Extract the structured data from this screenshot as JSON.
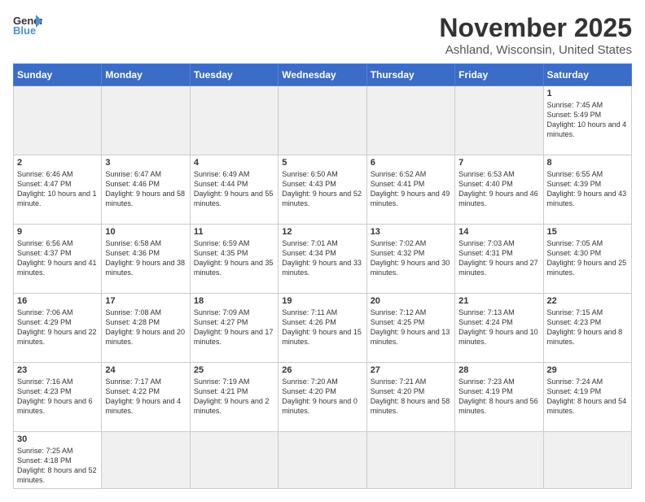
{
  "header": {
    "logo_general": "General",
    "logo_blue": "Blue",
    "month_year": "November 2025",
    "location": "Ashland, Wisconsin, United States"
  },
  "weekdays": [
    "Sunday",
    "Monday",
    "Tuesday",
    "Wednesday",
    "Thursday",
    "Friday",
    "Saturday"
  ],
  "weeks": [
    [
      {
        "day": "",
        "empty": true
      },
      {
        "day": "",
        "empty": true
      },
      {
        "day": "",
        "empty": true
      },
      {
        "day": "",
        "empty": true
      },
      {
        "day": "",
        "empty": true
      },
      {
        "day": "",
        "empty": true
      },
      {
        "day": "1",
        "info": "Sunrise: 7:45 AM\nSunset: 5:49 PM\nDaylight: 10 hours\nand 4 minutes."
      }
    ],
    [
      {
        "day": "2",
        "info": "Sunrise: 6:46 AM\nSunset: 4:47 PM\nDaylight: 10 hours\nand 1 minute."
      },
      {
        "day": "3",
        "info": "Sunrise: 6:47 AM\nSunset: 4:46 PM\nDaylight: 9 hours\nand 58 minutes."
      },
      {
        "day": "4",
        "info": "Sunrise: 6:49 AM\nSunset: 4:44 PM\nDaylight: 9 hours\nand 55 minutes."
      },
      {
        "day": "5",
        "info": "Sunrise: 6:50 AM\nSunset: 4:43 PM\nDaylight: 9 hours\nand 52 minutes."
      },
      {
        "day": "6",
        "info": "Sunrise: 6:52 AM\nSunset: 4:41 PM\nDaylight: 9 hours\nand 49 minutes."
      },
      {
        "day": "7",
        "info": "Sunrise: 6:53 AM\nSunset: 4:40 PM\nDaylight: 9 hours\nand 46 minutes."
      },
      {
        "day": "8",
        "info": "Sunrise: 6:55 AM\nSunset: 4:39 PM\nDaylight: 9 hours\nand 43 minutes."
      }
    ],
    [
      {
        "day": "9",
        "info": "Sunrise: 6:56 AM\nSunset: 4:37 PM\nDaylight: 9 hours\nand 41 minutes."
      },
      {
        "day": "10",
        "info": "Sunrise: 6:58 AM\nSunset: 4:36 PM\nDaylight: 9 hours\nand 38 minutes."
      },
      {
        "day": "11",
        "info": "Sunrise: 6:59 AM\nSunset: 4:35 PM\nDaylight: 9 hours\nand 35 minutes."
      },
      {
        "day": "12",
        "info": "Sunrise: 7:01 AM\nSunset: 4:34 PM\nDaylight: 9 hours\nand 33 minutes."
      },
      {
        "day": "13",
        "info": "Sunrise: 7:02 AM\nSunset: 4:32 PM\nDaylight: 9 hours\nand 30 minutes."
      },
      {
        "day": "14",
        "info": "Sunrise: 7:03 AM\nSunset: 4:31 PM\nDaylight: 9 hours\nand 27 minutes."
      },
      {
        "day": "15",
        "info": "Sunrise: 7:05 AM\nSunset: 4:30 PM\nDaylight: 9 hours\nand 25 minutes."
      }
    ],
    [
      {
        "day": "16",
        "info": "Sunrise: 7:06 AM\nSunset: 4:29 PM\nDaylight: 9 hours\nand 22 minutes."
      },
      {
        "day": "17",
        "info": "Sunrise: 7:08 AM\nSunset: 4:28 PM\nDaylight: 9 hours\nand 20 minutes."
      },
      {
        "day": "18",
        "info": "Sunrise: 7:09 AM\nSunset: 4:27 PM\nDaylight: 9 hours\nand 17 minutes."
      },
      {
        "day": "19",
        "info": "Sunrise: 7:11 AM\nSunset: 4:26 PM\nDaylight: 9 hours\nand 15 minutes."
      },
      {
        "day": "20",
        "info": "Sunrise: 7:12 AM\nSunset: 4:25 PM\nDaylight: 9 hours\nand 13 minutes."
      },
      {
        "day": "21",
        "info": "Sunrise: 7:13 AM\nSunset: 4:24 PM\nDaylight: 9 hours\nand 10 minutes."
      },
      {
        "day": "22",
        "info": "Sunrise: 7:15 AM\nSunset: 4:23 PM\nDaylight: 9 hours\nand 8 minutes."
      }
    ],
    [
      {
        "day": "23",
        "info": "Sunrise: 7:16 AM\nSunset: 4:23 PM\nDaylight: 9 hours\nand 6 minutes."
      },
      {
        "day": "24",
        "info": "Sunrise: 7:17 AM\nSunset: 4:22 PM\nDaylight: 9 hours\nand 4 minutes."
      },
      {
        "day": "25",
        "info": "Sunrise: 7:19 AM\nSunset: 4:21 PM\nDaylight: 9 hours\nand 2 minutes."
      },
      {
        "day": "26",
        "info": "Sunrise: 7:20 AM\nSunset: 4:20 PM\nDaylight: 9 hours\nand 0 minutes."
      },
      {
        "day": "27",
        "info": "Sunrise: 7:21 AM\nSunset: 4:20 PM\nDaylight: 8 hours\nand 58 minutes."
      },
      {
        "day": "28",
        "info": "Sunrise: 7:23 AM\nSunset: 4:19 PM\nDaylight: 8 hours\nand 56 minutes."
      },
      {
        "day": "29",
        "info": "Sunrise: 7:24 AM\nSunset: 4:19 PM\nDaylight: 8 hours\nand 54 minutes."
      }
    ],
    [
      {
        "day": "30",
        "info": "Sunrise: 7:25 AM\nSunset: 4:18 PM\nDaylight: 8 hours\nand 52 minutes."
      },
      {
        "day": "",
        "empty": true
      },
      {
        "day": "",
        "empty": true
      },
      {
        "day": "",
        "empty": true
      },
      {
        "day": "",
        "empty": true
      },
      {
        "day": "",
        "empty": true
      },
      {
        "day": "",
        "empty": true
      }
    ]
  ]
}
